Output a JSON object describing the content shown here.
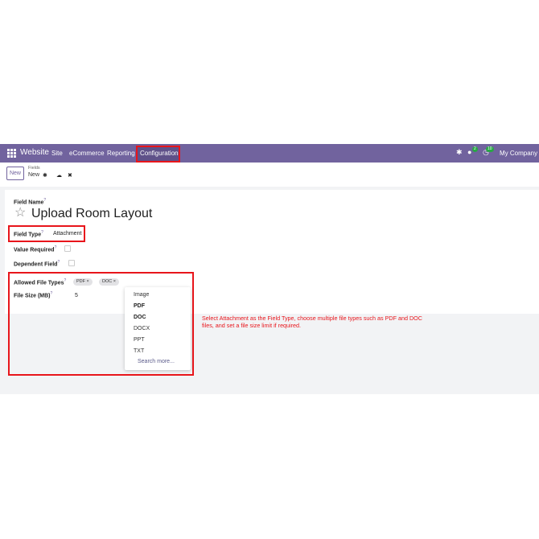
{
  "navbar": {
    "brand": "Website",
    "menu": [
      "Site",
      "eCommerce",
      "Reporting",
      "Configuration"
    ],
    "company": "My Company (S",
    "messages_badge": "2",
    "activity_badge": "10"
  },
  "control": {
    "new_label": "New",
    "breadcrumb_parent": "Fields",
    "breadcrumb_current": "New"
  },
  "form": {
    "field_name_label": "Field Name",
    "field_name_value": "Upload Room Layout",
    "field_type_label": "Field Type",
    "field_type_value": "Attachment",
    "value_required_label": "Value Required",
    "dependent_field_label": "Dependent Field",
    "allowed_file_types_label": "Allowed File Types",
    "tags": [
      "PDF",
      "DOC"
    ],
    "tag_remove": "×",
    "file_size_label": "File Size (MB)",
    "file_size_value": "5",
    "help_mark": "?"
  },
  "dropdown": {
    "options": [
      "Image",
      "PDF",
      "DOC",
      "DOCX",
      "PPT",
      "TXT"
    ],
    "search_more": "Search more..."
  },
  "annotation": "Select Attachment as the Field Type, choose multiple file types such as PDF and DOC files, and set a file size limit if required.",
  "colors": {
    "navbar": "#71639e",
    "highlight": "#e8151b",
    "background": "#f2f3f5"
  }
}
